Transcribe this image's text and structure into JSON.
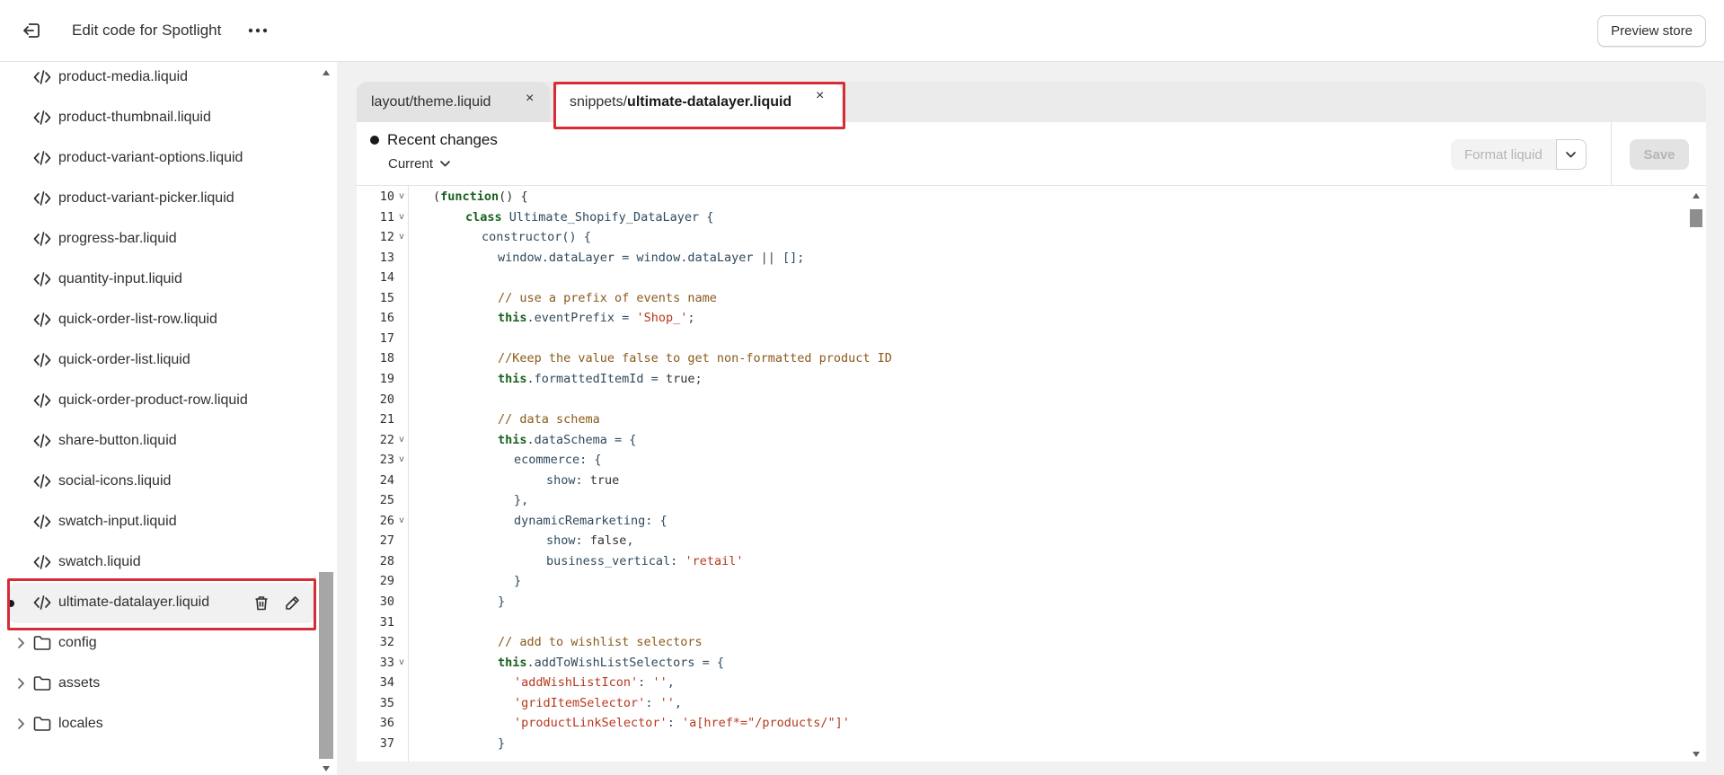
{
  "header": {
    "title": "Edit code for Spotlight",
    "preview_label": "Preview store"
  },
  "sidebar": {
    "files": [
      {
        "name": "product-media.liquid"
      },
      {
        "name": "product-thumbnail.liquid"
      },
      {
        "name": "product-variant-options.liquid"
      },
      {
        "name": "product-variant-picker.liquid"
      },
      {
        "name": "progress-bar.liquid"
      },
      {
        "name": "quantity-input.liquid"
      },
      {
        "name": "quick-order-list-row.liquid"
      },
      {
        "name": "quick-order-list.liquid"
      },
      {
        "name": "quick-order-product-row.liquid"
      },
      {
        "name": "share-button.liquid"
      },
      {
        "name": "social-icons.liquid"
      },
      {
        "name": "swatch-input.liquid"
      },
      {
        "name": "swatch.liquid"
      }
    ],
    "active_file": {
      "name": "ultimate-datalayer.liquid",
      "modified": true
    },
    "folders": [
      {
        "name": "config"
      },
      {
        "name": "assets"
      },
      {
        "name": "locales"
      }
    ]
  },
  "tabs": [
    {
      "label": "layout/theme.liquid",
      "close": "×"
    },
    {
      "prefix": "snippets/",
      "bold": "ultimate-datalayer.liquid",
      "close": "×",
      "active": true
    }
  ],
  "editor": {
    "changes_label": "Recent changes",
    "version_label": "Current",
    "format_label": "Format liquid",
    "save_label": "Save",
    "lines": [
      {
        "n": "10",
        "fold": true,
        "tokens": [
          {
            "t": "(",
            "c": "lit"
          },
          {
            "t": "function",
            "c": "kw"
          },
          {
            "t": "() {",
            "c": "lit"
          }
        ],
        "indent": 0
      },
      {
        "n": "11",
        "fold": true,
        "tokens": [
          {
            "t": "class",
            "c": "kw"
          },
          {
            "t": " Ultimate_Shopify_DataLayer {",
            "c": "plain"
          }
        ],
        "indent": 2
      },
      {
        "n": "12",
        "fold": true,
        "tokens": [
          {
            "t": "constructor() {",
            "c": "plain"
          }
        ],
        "indent": 3
      },
      {
        "n": "13",
        "fold": false,
        "tokens": [
          {
            "t": "window.dataLayer = window.dataLayer || [];",
            "c": "plain"
          }
        ],
        "indent": 4
      },
      {
        "n": "14",
        "fold": false,
        "tokens": [],
        "indent": 0
      },
      {
        "n": "15",
        "fold": false,
        "tokens": [
          {
            "t": "// use a prefix of events name",
            "c": "cm"
          }
        ],
        "indent": 4
      },
      {
        "n": "16",
        "fold": false,
        "tokens": [
          {
            "t": "this",
            "c": "kw"
          },
          {
            "t": ".eventPrefix = ",
            "c": "plain"
          },
          {
            "t": "'Shop_'",
            "c": "str"
          },
          {
            "t": ";",
            "c": "plain"
          }
        ],
        "indent": 4
      },
      {
        "n": "17",
        "fold": false,
        "tokens": [],
        "indent": 0
      },
      {
        "n": "18",
        "fold": false,
        "tokens": [
          {
            "t": "//Keep the value false to get non-formatted product ID",
            "c": "cm"
          }
        ],
        "indent": 4
      },
      {
        "n": "19",
        "fold": false,
        "tokens": [
          {
            "t": "this",
            "c": "kw"
          },
          {
            "t": ".formattedItemId = ",
            "c": "plain"
          },
          {
            "t": "true",
            "c": "lit"
          },
          {
            "t": ";",
            "c": "plain"
          }
        ],
        "indent": 4
      },
      {
        "n": "20",
        "fold": false,
        "tokens": [],
        "indent": 0
      },
      {
        "n": "21",
        "fold": false,
        "tokens": [
          {
            "t": "// data schema",
            "c": "cm"
          }
        ],
        "indent": 4
      },
      {
        "n": "22",
        "fold": true,
        "tokens": [
          {
            "t": "this",
            "c": "kw"
          },
          {
            "t": ".dataSchema = {",
            "c": "plain"
          }
        ],
        "indent": 4
      },
      {
        "n": "23",
        "fold": true,
        "tokens": [
          {
            "t": "ecommerce: {",
            "c": "plain"
          }
        ],
        "indent": 5
      },
      {
        "n": "24",
        "fold": false,
        "tokens": [
          {
            "t": "show: ",
            "c": "plain"
          },
          {
            "t": "true",
            "c": "lit"
          }
        ],
        "indent": 7
      },
      {
        "n": "25",
        "fold": false,
        "tokens": [
          {
            "t": "},",
            "c": "plain"
          }
        ],
        "indent": 5
      },
      {
        "n": "26",
        "fold": true,
        "tokens": [
          {
            "t": "dynamicRemarketing: {",
            "c": "plain"
          }
        ],
        "indent": 5
      },
      {
        "n": "27",
        "fold": false,
        "tokens": [
          {
            "t": "show: ",
            "c": "plain"
          },
          {
            "t": "false",
            "c": "lit"
          },
          {
            "t": ",",
            "c": "plain"
          }
        ],
        "indent": 7
      },
      {
        "n": "28",
        "fold": false,
        "tokens": [
          {
            "t": "business_vertical: ",
            "c": "plain"
          },
          {
            "t": "'retail'",
            "c": "str"
          }
        ],
        "indent": 7
      },
      {
        "n": "29",
        "fold": false,
        "tokens": [
          {
            "t": "}",
            "c": "plain"
          }
        ],
        "indent": 5
      },
      {
        "n": "30",
        "fold": false,
        "tokens": [
          {
            "t": "}",
            "c": "plain"
          }
        ],
        "indent": 4
      },
      {
        "n": "31",
        "fold": false,
        "tokens": [],
        "indent": 0
      },
      {
        "n": "32",
        "fold": false,
        "tokens": [
          {
            "t": "// add to wishlist selectors",
            "c": "cm"
          }
        ],
        "indent": 4
      },
      {
        "n": "33",
        "fold": true,
        "tokens": [
          {
            "t": "this",
            "c": "kw"
          },
          {
            "t": ".addToWishListSelectors = {",
            "c": "plain"
          }
        ],
        "indent": 4
      },
      {
        "n": "34",
        "fold": false,
        "tokens": [
          {
            "t": "'addWishListIcon'",
            "c": "str"
          },
          {
            "t": ": ",
            "c": "plain"
          },
          {
            "t": "''",
            "c": "str"
          },
          {
            "t": ",",
            "c": "plain"
          }
        ],
        "indent": 5
      },
      {
        "n": "35",
        "fold": false,
        "tokens": [
          {
            "t": "'gridItemSelector'",
            "c": "str"
          },
          {
            "t": ": ",
            "c": "plain"
          },
          {
            "t": "''",
            "c": "str"
          },
          {
            "t": ",",
            "c": "plain"
          }
        ],
        "indent": 5
      },
      {
        "n": "36",
        "fold": false,
        "tokens": [
          {
            "t": "'productLinkSelector'",
            "c": "str"
          },
          {
            "t": ": ",
            "c": "plain"
          },
          {
            "t": "'a[href*=\"/products/\"]'",
            "c": "str"
          }
        ],
        "indent": 5
      },
      {
        "n": "37",
        "fold": false,
        "tokens": [
          {
            "t": "}",
            "c": "plain"
          }
        ],
        "indent": 4
      }
    ]
  },
  "colors": {
    "highlight": "#d72c36",
    "keyword": "#18621f",
    "comment": "#8a5a1b",
    "string": "#b5381c"
  }
}
